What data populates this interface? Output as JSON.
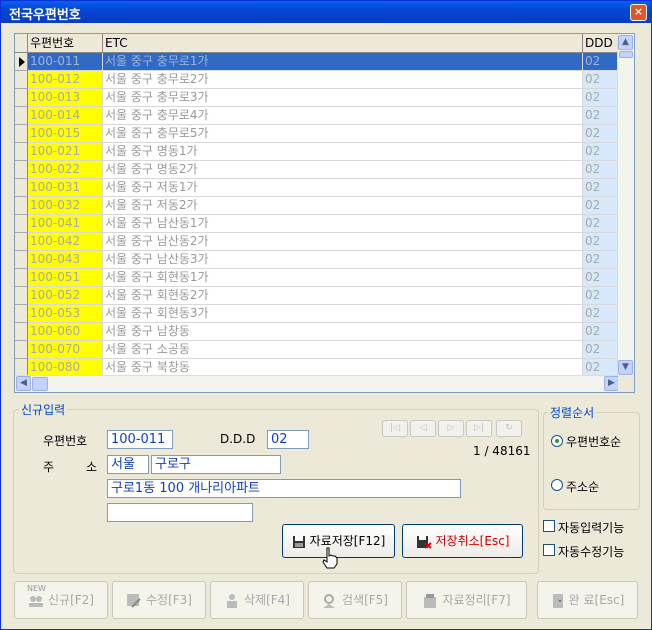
{
  "window": {
    "title": "전국우편번호",
    "close": "×"
  },
  "grid": {
    "columns": {
      "zip": "우편번호",
      "etc": "ETC",
      "ddd": "DDD"
    },
    "selected_index": 0,
    "rows": [
      {
        "zip": "100-011",
        "etc": "서울 중구 충무로1가",
        "ddd": "02"
      },
      {
        "zip": "100-012",
        "etc": "서울 중구 충무로2가",
        "ddd": "02"
      },
      {
        "zip": "100-013",
        "etc": "서울 중구 충무로3가",
        "ddd": "02"
      },
      {
        "zip": "100-014",
        "etc": "서울 중구 충무로4가",
        "ddd": "02"
      },
      {
        "zip": "100-015",
        "etc": "서울 중구 충무로5가",
        "ddd": "02"
      },
      {
        "zip": "100-021",
        "etc": "서울 중구 명동1가",
        "ddd": "02"
      },
      {
        "zip": "100-022",
        "etc": "서울 중구 명동2가",
        "ddd": "02"
      },
      {
        "zip": "100-031",
        "etc": "서울 중구 저동1가",
        "ddd": "02"
      },
      {
        "zip": "100-032",
        "etc": "서울 중구 저동2가",
        "ddd": "02"
      },
      {
        "zip": "100-041",
        "etc": "서울 중구 남산동1가",
        "ddd": "02"
      },
      {
        "zip": "100-042",
        "etc": "서울 중구 남산동2가",
        "ddd": "02"
      },
      {
        "zip": "100-043",
        "etc": "서울 중구 남산동3가",
        "ddd": "02"
      },
      {
        "zip": "100-051",
        "etc": "서울 중구 회현동1가",
        "ddd": "02"
      },
      {
        "zip": "100-052",
        "etc": "서울 중구 회현동2가",
        "ddd": "02"
      },
      {
        "zip": "100-053",
        "etc": "서울 중구 회현동3가",
        "ddd": "02"
      },
      {
        "zip": "100-060",
        "etc": "서울 중구 남창동",
        "ddd": "02"
      },
      {
        "zip": "100-070",
        "etc": "서울 중구 소공동",
        "ddd": "02"
      },
      {
        "zip": "100-080",
        "etc": "서울 중구 북창동",
        "ddd": "02"
      }
    ]
  },
  "form": {
    "group_label": "신규입력",
    "zip_label": "우편번호",
    "zip_value": "100-011",
    "ddd_label": "D.D.D",
    "ddd_value": "02",
    "addr_label_1": "주",
    "addr_label_2": "소",
    "addr_city": "서울",
    "addr_district": "구로구",
    "addr_line": "구로1동 100 개나리아파트",
    "addr_extra": "",
    "record_counter": "1 / 48161",
    "save_label": "자료저장[F12]",
    "cancel_label": "저장취소[Esc]"
  },
  "sort": {
    "group_label": "정렬순서",
    "options": [
      "우편번호순",
      "주소순"
    ],
    "selected": "우편번호순"
  },
  "options": {
    "auto_input": "자동입력기능",
    "auto_edit": "자동수정기능"
  },
  "toolbar": {
    "new": "신규[F2]",
    "new_badge": "NEW",
    "edit": "수정[F3]",
    "delete": "삭제[F4]",
    "search": "검색[F5]",
    "organize": "자료정리[F7]",
    "done": "완 료[Esc]"
  }
}
